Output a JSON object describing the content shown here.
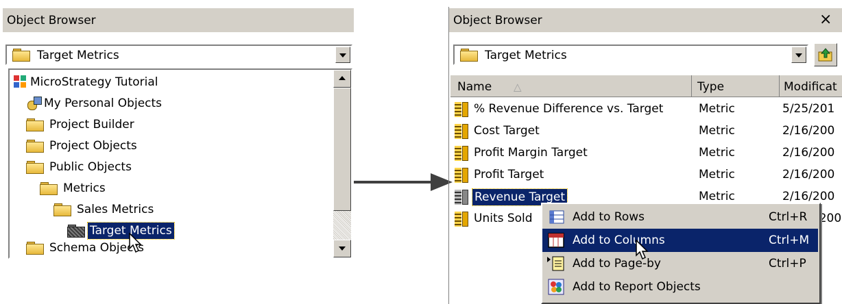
{
  "left_panel": {
    "title": "Object Browser",
    "folder_combo": {
      "value": "Target Metrics"
    },
    "tree": [
      {
        "label": "MicroStrategy Tutorial"
      },
      {
        "label": "My Personal Objects"
      },
      {
        "label": "Project Builder"
      },
      {
        "label": "Project Objects"
      },
      {
        "label": "Public Objects"
      },
      {
        "label": "Metrics"
      },
      {
        "label": "Sales Metrics"
      },
      {
        "label": "Target Metrics",
        "selected": true
      },
      {
        "label": "Schema Objects"
      }
    ]
  },
  "right_panel": {
    "title": "Object Browser",
    "close_glyph": "×",
    "folder_combo": {
      "value": "Target Metrics"
    },
    "columns": {
      "name": "Name",
      "sort_glyph": "△",
      "type": "Type",
      "modified": "Modificat"
    },
    "rows": [
      {
        "name": "% Revenue Difference vs. Target",
        "type": "Metric",
        "modified": "5/25/201"
      },
      {
        "name": "Cost Target",
        "type": "Metric",
        "modified": "2/16/200"
      },
      {
        "name": "Profit Margin Target",
        "type": "Metric",
        "modified": "2/16/200"
      },
      {
        "name": "Profit Target",
        "type": "Metric",
        "modified": "2/16/200"
      },
      {
        "name": "Revenue Target",
        "type": "Metric",
        "modified": "2/16/200",
        "selected": true
      },
      {
        "name": "Units Sold",
        "type": "",
        "modified": "/200"
      }
    ],
    "context_menu": [
      {
        "label": "Add to Rows",
        "shortcut": "Ctrl+R",
        "icon": "rows-grid-icon"
      },
      {
        "label": "Add to Columns",
        "shortcut": "Ctrl+M",
        "icon": "columns-grid-icon",
        "highlighted": true
      },
      {
        "label": "Add to Page-by",
        "shortcut": "Ctrl+P",
        "icon": "page-by-icon"
      },
      {
        "label": "Add to Report Objects",
        "shortcut": "",
        "icon": "report-objects-icon"
      }
    ]
  },
  "colors": {
    "selection": "#0a246a",
    "chrome": "#d4d0c8"
  }
}
